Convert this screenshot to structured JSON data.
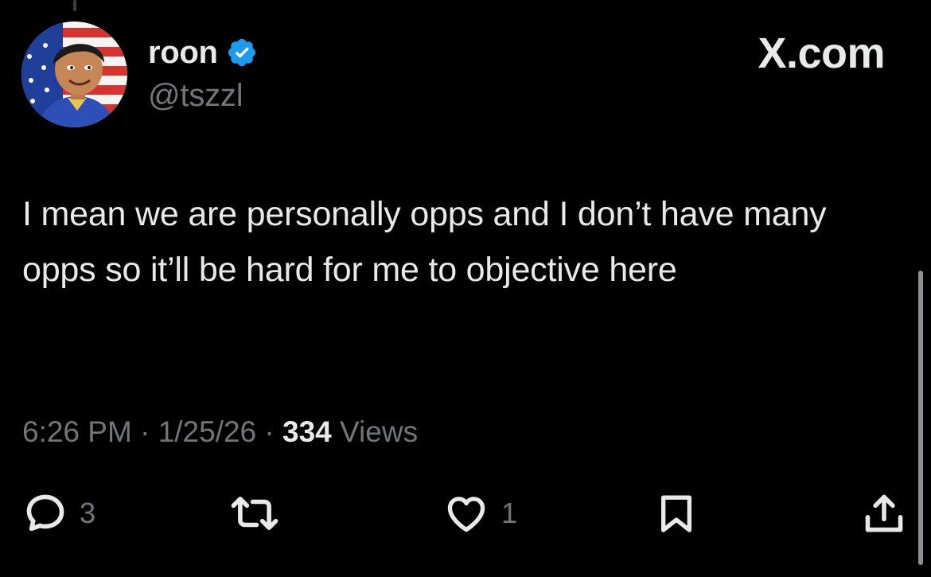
{
  "author": {
    "display_name": "roon",
    "handle": "@tszzl",
    "verified": true
  },
  "site_label": "X.com",
  "tweet": {
    "text": "I mean we are personally opps and I don’t have many opps so it’ll be hard for me to objective here",
    "time": "6:26 PM",
    "date": "1/25/26",
    "separator": "·",
    "views_count": "334",
    "views_label": "Views"
  },
  "actions": {
    "reply_count": "3",
    "repost_count": "",
    "like_count": "1"
  },
  "colors": {
    "background": "#000000",
    "text": "#e7e9ea",
    "muted": "#71767b",
    "verified_blue": "#1d9bf0"
  },
  "icons": {
    "reply": "speech-bubble-icon",
    "repost": "repost-arrows-icon",
    "like": "heart-icon",
    "bookmark": "bookmark-icon",
    "share": "share-upload-icon",
    "verified": "verified-badge-icon"
  }
}
